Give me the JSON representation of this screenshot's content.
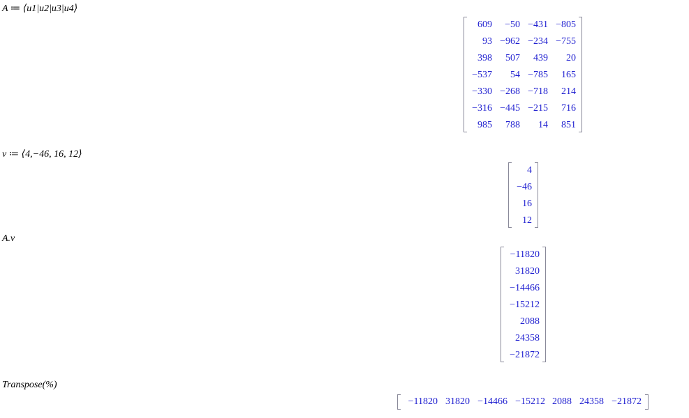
{
  "colors": {
    "input_text": "#000000",
    "output_text": "#1f1fd0",
    "bracket": "#8a8a9a"
  },
  "inputs": {
    "assign_A": "A ≔ ⟨u1|u2|u3|u4⟩",
    "assign_v": "v ≔ ⟨4,−46, 16, 12⟩",
    "product": "A.v",
    "transpose": "Transpose(%)"
  },
  "outputs": {
    "A": [
      [
        "609",
        "−50",
        "−431",
        "−805"
      ],
      [
        "93",
        "−962",
        "−234",
        "−755"
      ],
      [
        "398",
        "507",
        "439",
        "20"
      ],
      [
        "−537",
        "54",
        "−785",
        "165"
      ],
      [
        "−330",
        "−268",
        "−718",
        "214"
      ],
      [
        "−316",
        "−445",
        "−215",
        "716"
      ],
      [
        "985",
        "788",
        "14",
        "851"
      ]
    ],
    "v": [
      "4",
      "−46",
      "16",
      "12"
    ],
    "Av": [
      "−11820",
      "31820",
      "−14466",
      "−15212",
      "2088",
      "24358",
      "−21872"
    ],
    "transpose": [
      "−11820",
      "31820",
      "−14466",
      "−15212",
      "2088",
      "24358",
      "−21872"
    ]
  }
}
